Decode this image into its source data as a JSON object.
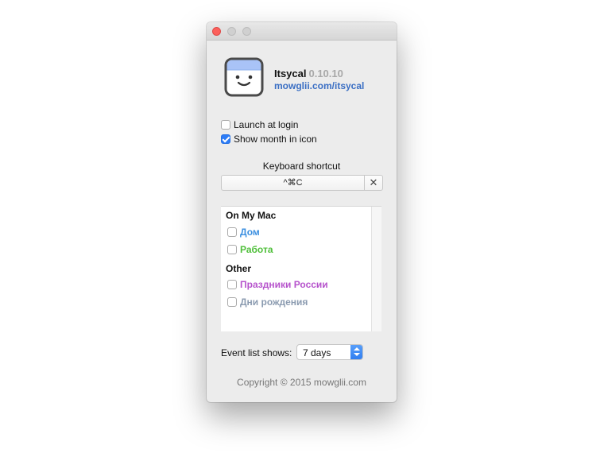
{
  "app": {
    "name": "Itsycal",
    "version": "0.10.10",
    "link": "mowglii.com/itsycal",
    "icon": "smiley-calendar-icon"
  },
  "options": {
    "launch_at_login": {
      "label": "Launch at login",
      "checked": false
    },
    "show_month": {
      "label": "Show month in icon",
      "checked": true
    }
  },
  "shortcut": {
    "label": "Keyboard shortcut",
    "value": "^⌘C",
    "clear": "✕"
  },
  "calendars": {
    "groups": [
      {
        "title": "On My Mac",
        "items": [
          {
            "label": "Дом",
            "color": "#3b8fe0",
            "checked": false
          },
          {
            "label": "Работа",
            "color": "#4fbf3a",
            "checked": false
          }
        ]
      },
      {
        "title": "Other",
        "items": [
          {
            "label": "Праздники России",
            "color": "#b653cc",
            "checked": false
          },
          {
            "label": "Дни рождения",
            "color": "#8b9bb0",
            "checked": false
          }
        ]
      }
    ]
  },
  "event_list": {
    "label": "Event list shows:",
    "value": "7 days"
  },
  "footer": {
    "copyright": "Copyright © 2015 mowglii.com"
  },
  "colors": {
    "accent": "#2d7cf6",
    "link": "#3b6fc4",
    "close_button": "#fc605c"
  }
}
